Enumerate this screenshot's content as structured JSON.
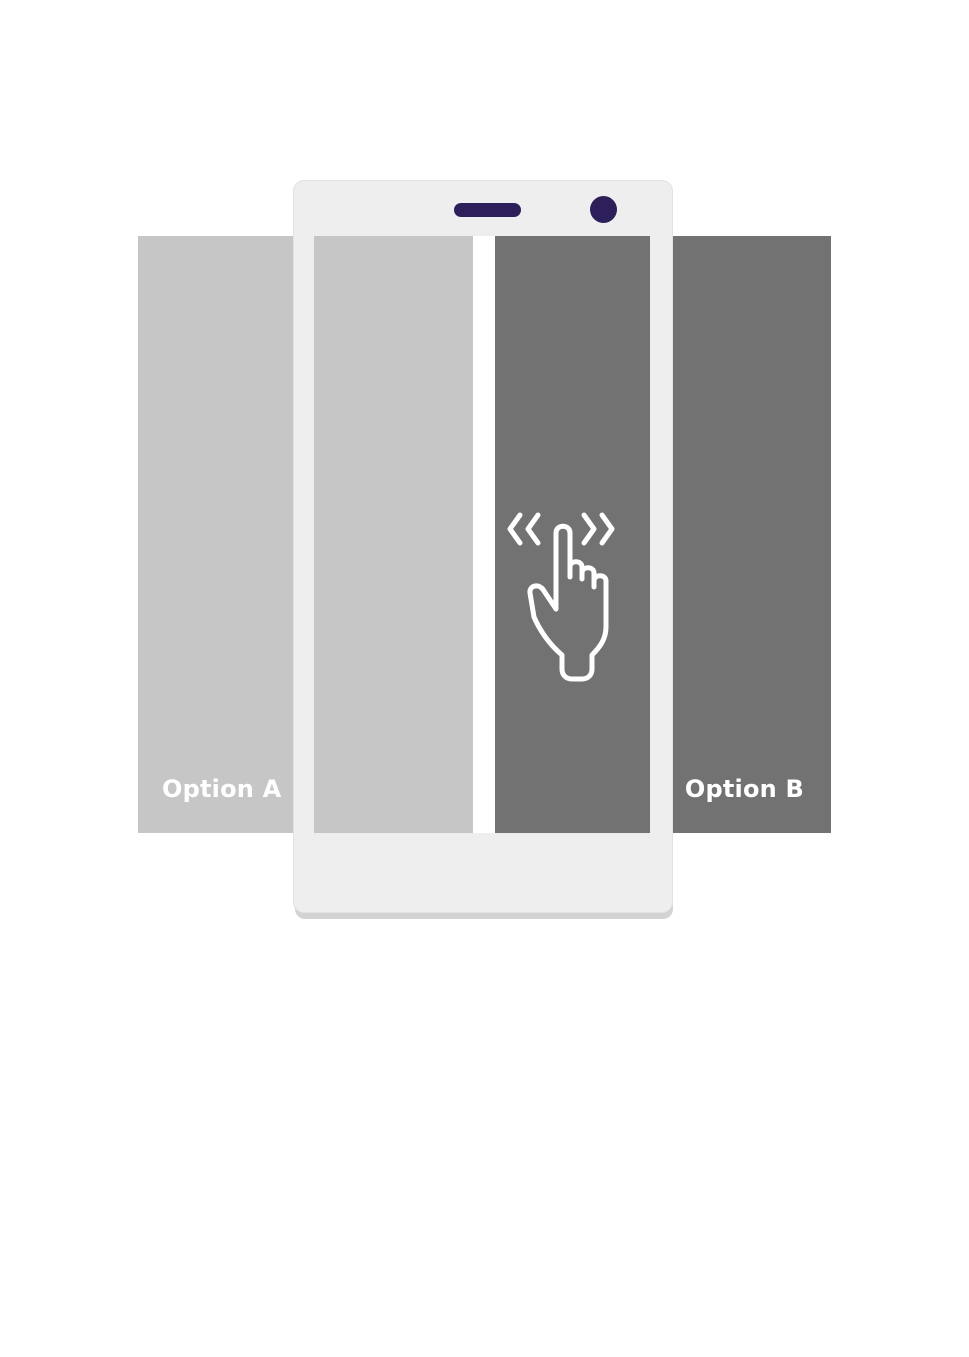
{
  "options": {
    "left_label": "Option A",
    "right_label": "Option B"
  },
  "colors": {
    "option_a": "#c6c6c6",
    "option_b": "#727272",
    "phone_body": "#eeeeee",
    "phone_accent": "#2d1f5a",
    "divider": "#ffffff"
  },
  "icons": {
    "gesture": "swipe-left-right-hand-icon",
    "speaker": "phone-speaker",
    "camera": "phone-camera"
  }
}
